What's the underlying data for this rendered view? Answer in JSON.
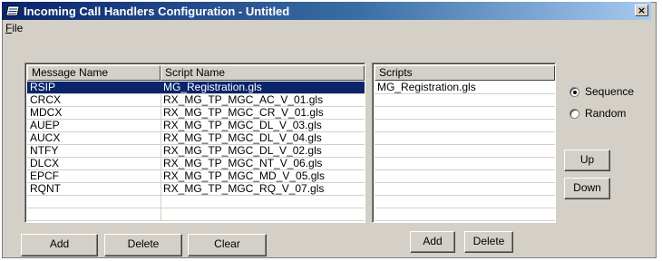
{
  "window": {
    "title": "Incoming Call Handlers Configuration - Untitled",
    "close_glyph": "×"
  },
  "menu": {
    "file_label_accel": "F",
    "file_label_rest": "ile"
  },
  "message_table": {
    "columns": [
      "Message Name",
      "Script Name"
    ],
    "rows": [
      {
        "message": "RSIP",
        "script": "MG_Registration.gls",
        "selected": true
      },
      {
        "message": "CRCX",
        "script": "RX_MG_TP_MGC_AC_V_01.gls",
        "selected": false
      },
      {
        "message": "MDCX",
        "script": "RX_MG_TP_MGC_CR_V_01.gls",
        "selected": false
      },
      {
        "message": "AUEP",
        "script": "RX_MG_TP_MGC_DL_V_03.gls",
        "selected": false
      },
      {
        "message": "AUCX",
        "script": "RX_MG_TP_MGC_DL_V_04.gls",
        "selected": false
      },
      {
        "message": "NTFY",
        "script": "RX_MG_TP_MGC_DL_V_02.gls",
        "selected": false
      },
      {
        "message": "DLCX",
        "script": "RX_MG_TP_MGC_NT_V_06.gls",
        "selected": false
      },
      {
        "message": "EPCF",
        "script": "RX_MG_TP_MGC_MD_V_05.gls",
        "selected": false
      },
      {
        "message": "RQNT",
        "script": "RX_MG_TP_MGC_RQ_V_07.gls",
        "selected": false
      }
    ]
  },
  "scripts_table": {
    "column": "Scripts",
    "rows": [
      "MG_Registration.gls"
    ]
  },
  "buttons": {
    "add": "Add",
    "delete": "Delete",
    "clear": "Clear",
    "scripts_add": "Add",
    "scripts_delete": "Delete",
    "up": "Up",
    "down": "Down"
  },
  "order": {
    "sequence_label": "Sequence",
    "random_label": "Random",
    "selected": "Sequence"
  },
  "colors": {
    "selection": "#0a246a",
    "face": "#d4d0c8",
    "title_start": "#0a246a",
    "title_end": "#a6caf0"
  },
  "icons": {
    "title": "list-window-icon",
    "close": "close-icon"
  }
}
